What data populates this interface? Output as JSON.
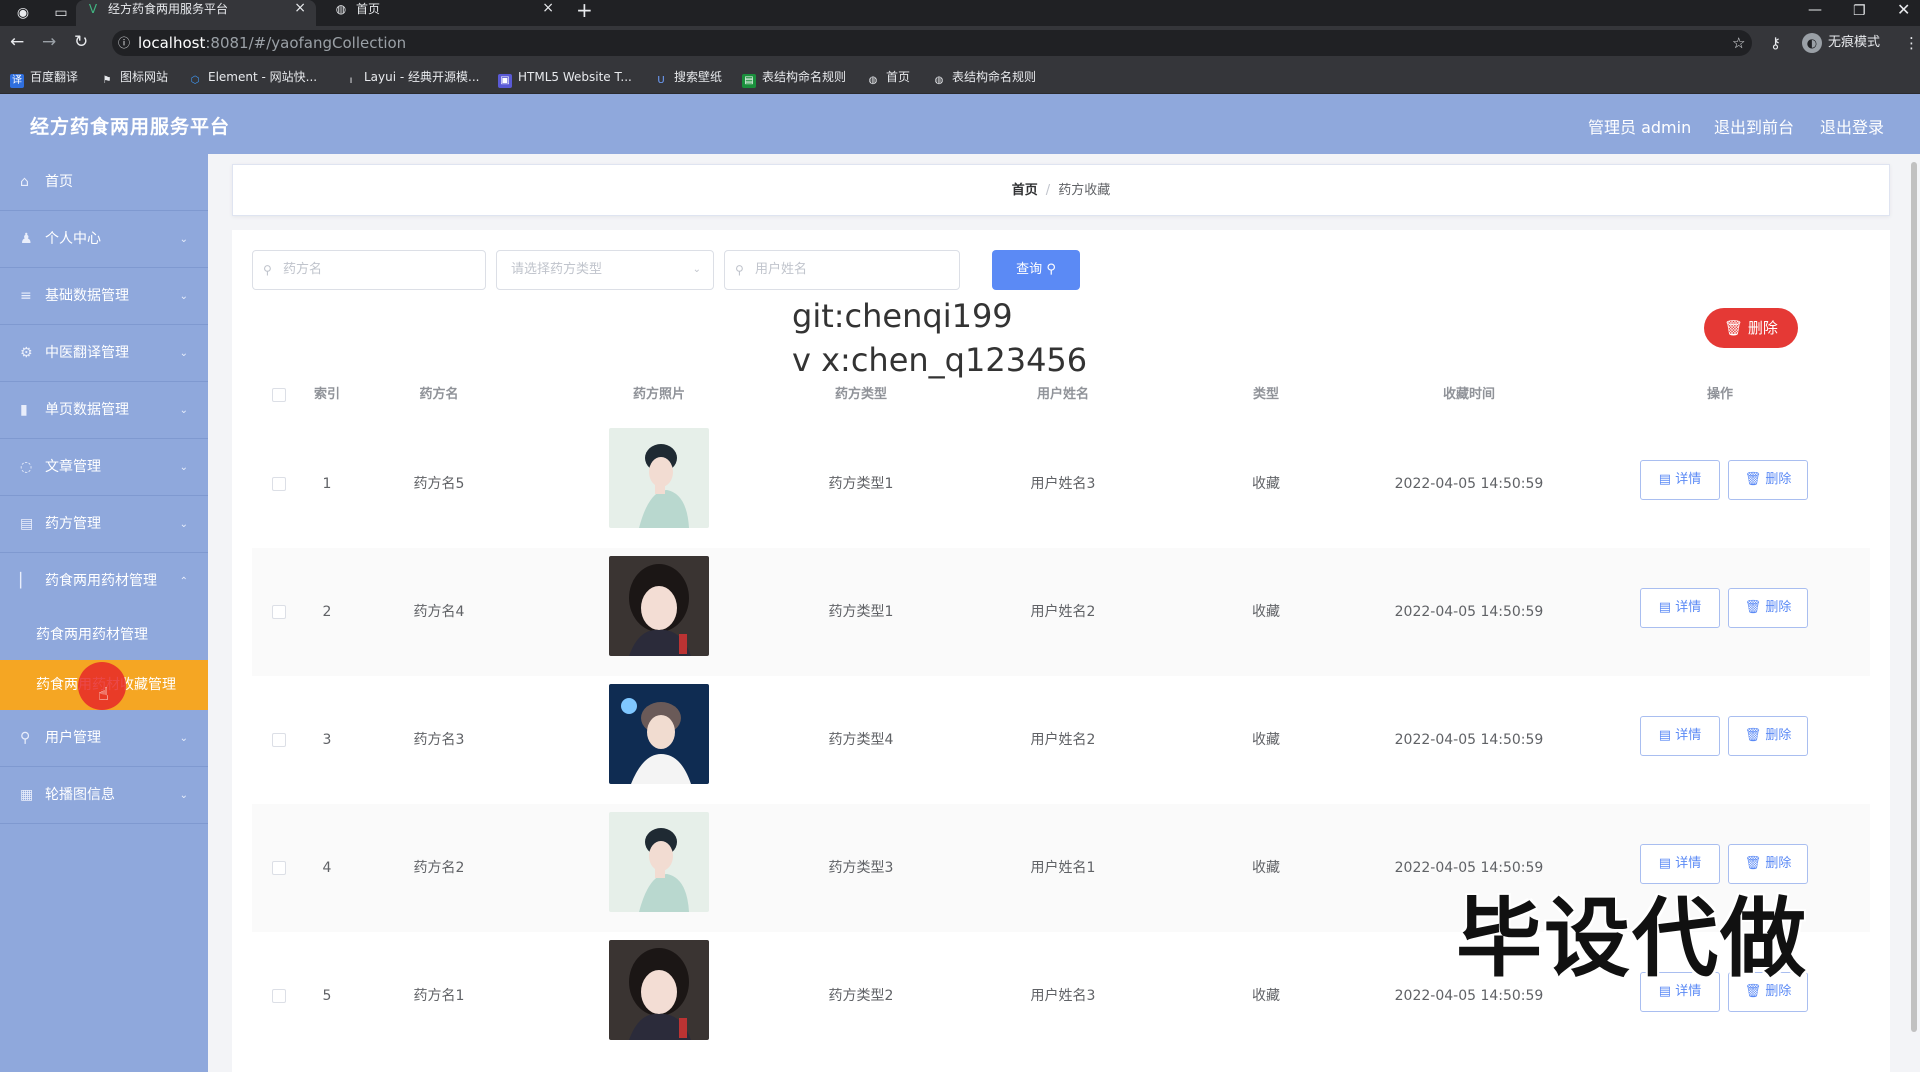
{
  "browser": {
    "tabs": [
      {
        "title": "经方药食两用服务平台",
        "icon": "vue-icon"
      },
      {
        "title": "首页",
        "icon": "globe-icon"
      }
    ],
    "url_host": "localhost",
    "url_path": ":8081/#/yaofangCollection",
    "incognito_label": "无痕模式",
    "bookmarks": [
      "百度翻译",
      "图标网站",
      "Element - 网站快...",
      "Layui - 经典开源模...",
      "HTML5 Website T...",
      "搜索壁纸",
      "表结构命名规则",
      "首页",
      "表结构命名规则"
    ]
  },
  "app": {
    "title": "经方药食两用服务平台",
    "header_links": [
      "管理员 admin",
      "退出到前台",
      "退出登录"
    ],
    "accent_color": "#8fa8dc",
    "active_color": "#f5a623"
  },
  "sidebar": {
    "items": [
      {
        "label": "首页",
        "icon": "home-icon"
      },
      {
        "label": "个人中心",
        "icon": "user-icon"
      },
      {
        "label": "基础数据管理",
        "icon": "list-icon"
      },
      {
        "label": "中医翻译管理",
        "icon": "settings-icon"
      },
      {
        "label": "单页数据管理",
        "icon": "chart-icon"
      },
      {
        "label": "文章管理",
        "icon": "circle-icon"
      },
      {
        "label": "药方管理",
        "icon": "menu-icon"
      },
      {
        "label": "药食两用药材管理",
        "icon": "bar-icon"
      }
    ],
    "sub_items": [
      "药食两用药材管理",
      "药食两用药材收藏管理"
    ],
    "bottom_items": [
      {
        "label": "用户管理",
        "icon": "pin-icon"
      },
      {
        "label": "轮播图信息",
        "icon": "image-icon"
      }
    ]
  },
  "breadcrumb": {
    "home": "首页",
    "current": "药方收藏"
  },
  "search": {
    "name_placeholder": "药方名",
    "type_placeholder": "请选择药方类型",
    "user_placeholder": "用户姓名",
    "query_label": "查询"
  },
  "overlay": {
    "line1": "git:chenqi199",
    "line2": "v x:chen_q123456",
    "big_text": "毕设代做"
  },
  "delete_all_label": "删除",
  "table": {
    "headers": [
      "索引",
      "药方名",
      "药方照片",
      "药方类型",
      "用户姓名",
      "类型",
      "收藏时间",
      "操作"
    ],
    "rows": [
      {
        "index": "1",
        "name": "药方名5",
        "type": "药方类型1",
        "user": "用户姓名3",
        "kind": "收藏",
        "time": "2022-04-05 14:50:59",
        "photo": "photo-a"
      },
      {
        "index": "2",
        "name": "药方名4",
        "type": "药方类型1",
        "user": "用户姓名2",
        "kind": "收藏",
        "time": "2022-04-05 14:50:59",
        "photo": "photo-b"
      },
      {
        "index": "3",
        "name": "药方名3",
        "type": "药方类型4",
        "user": "用户姓名2",
        "kind": "收藏",
        "time": "2022-04-05 14:50:59",
        "photo": "photo-c"
      },
      {
        "index": "4",
        "name": "药方名2",
        "type": "药方类型3",
        "user": "用户姓名1",
        "kind": "收藏",
        "time": "2022-04-05 14:50:59",
        "photo": "photo-a"
      },
      {
        "index": "5",
        "name": "药方名1",
        "type": "药方类型2",
        "user": "用户姓名3",
        "kind": "收藏",
        "time": "2022-04-05 14:50:59",
        "photo": "photo-b"
      }
    ],
    "detail_label": "详情",
    "delete_label": "删除"
  }
}
